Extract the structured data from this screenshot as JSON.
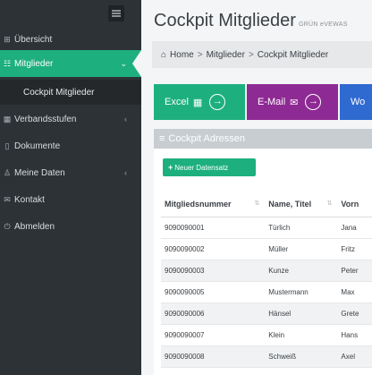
{
  "sidebar": {
    "items": [
      {
        "label": "Übersicht",
        "icon": "dashboard-icon",
        "glyph": "⊞"
      },
      {
        "label": "Mitglieder",
        "icon": "users-icon",
        "glyph": "☷",
        "chevron": "⌄",
        "active": true
      },
      {
        "label": "Verbandsstufen",
        "icon": "table-icon",
        "glyph": "▦",
        "chevron": "‹"
      },
      {
        "label": "Dokumente",
        "icon": "document-icon",
        "glyph": "▯"
      },
      {
        "label": "Meine Daten",
        "icon": "user-icon",
        "glyph": "♙",
        "chevron": "‹"
      },
      {
        "label": "Kontakt",
        "icon": "mail-icon",
        "glyph": "✉"
      },
      {
        "label": "Abmelden",
        "icon": "logout-icon",
        "glyph": "⏻"
      }
    ],
    "sub_item": "Cockpit Mitglieder",
    "accent": "#1db07e",
    "background": "#2d3236"
  },
  "header": {
    "title": "Cockpit Mitglieder",
    "subtitle": "GRÜN eVEWAS"
  },
  "breadcrumb": {
    "home": "Home",
    "items": [
      "Mitglieder",
      "Cockpit Mitglieder"
    ],
    "sep": ">",
    "home_glyph": "⌂"
  },
  "actions": {
    "excel": {
      "label": "Excel",
      "icon": "grid-icon",
      "glyph": "▦",
      "arrow": "→",
      "color": "#1db07e"
    },
    "email": {
      "label": "E-Mail",
      "icon": "envelope-icon",
      "glyph": "✉",
      "arrow": "→",
      "color": "#8e2a93"
    },
    "more": {
      "label": "Wo",
      "color": "#2f6ad1"
    }
  },
  "panel": {
    "title": "Cockpit Adressen",
    "glyph": "≡",
    "new_button": "Neuer Datensatz",
    "plus": "+"
  },
  "table": {
    "headers": [
      "Mitgliedsnummer",
      "Name, Titel",
      "Vorn"
    ],
    "rows": [
      [
        "9090090001",
        "Türlich",
        "Jana"
      ],
      [
        "9090090002",
        "Müller",
        "Fritz"
      ],
      [
        "9090090003",
        "Kunze",
        "Peter"
      ],
      [
        "9090090005",
        "Mustermann",
        "Max"
      ],
      [
        "9090090006",
        "Hänsel",
        "Grete"
      ],
      [
        "9090090007",
        "Klein",
        "Hans"
      ],
      [
        "9090090008",
        "Schweiß",
        "Axel"
      ]
    ]
  }
}
